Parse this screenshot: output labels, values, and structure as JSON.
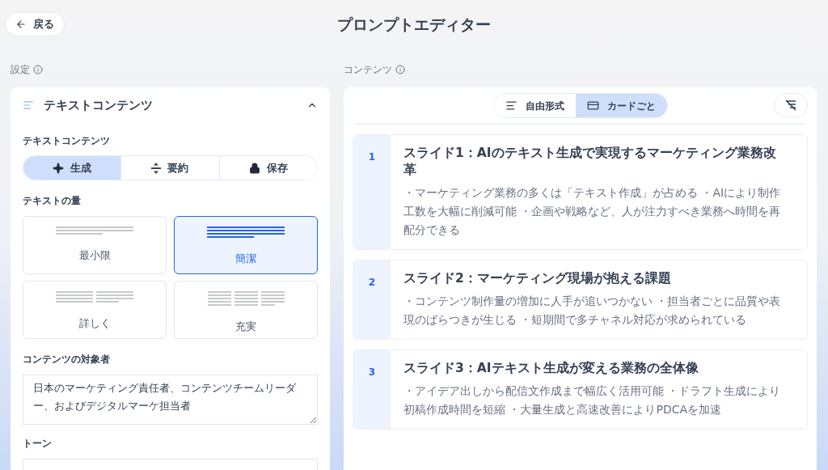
{
  "header": {
    "back_label": "戻る",
    "title": "プロンプトエディター"
  },
  "settings": {
    "label": "設定",
    "panel_title": "テキストコンテンツ",
    "expanded": true,
    "mode_label": "テキストコンテンツ",
    "modes": [
      {
        "kind": "generate",
        "label": "生成",
        "selected": true
      },
      {
        "kind": "summarize",
        "label": "要約",
        "selected": false
      },
      {
        "kind": "preserve",
        "label": "保存",
        "selected": false
      }
    ],
    "amount_label": "テキストの量",
    "amounts": [
      {
        "kind": "minimal",
        "label": "最小限",
        "selected": false
      },
      {
        "kind": "concise",
        "label": "簡潔",
        "selected": true
      },
      {
        "kind": "detailed",
        "label": "詳しく",
        "selected": false
      },
      {
        "kind": "full",
        "label": "充実",
        "selected": false
      }
    ],
    "audience_label": "コンテンツの対象者",
    "audience_value": "日本のマーケティング責任者、コンテンツチームリーダー、およびデジタルマーケ担当者",
    "tone_label": "トーン"
  },
  "content": {
    "label": "コンテンツ",
    "views": [
      {
        "kind": "freeform",
        "label": "自由形式",
        "selected": false
      },
      {
        "kind": "cards",
        "label": "カードごと",
        "selected": true
      }
    ],
    "cards": [
      {
        "number": "1",
        "title": "スライド1：AIのテキスト生成で実現するマーケティング業務改革",
        "body": "・マーケティング業務の多くは「テキスト作成」が占める ・AIにより制作工数を大幅に削減可能 ・企画や戦略など、人が注力すべき業務へ時間を再配分できる"
      },
      {
        "number": "2",
        "title": "スライド2：マーケティング現場が抱える課題",
        "body": "・コンテンツ制作量の増加に人手が追いつかない ・担当者ごとに品質や表現のばらつきが生じる ・短期間で多チャネル対応が求められている"
      },
      {
        "number": "3",
        "title": "スライド3：AIテキスト生成が変える業務の全体像",
        "body": "・アイデア出しから配信文作成まで幅広く活用可能 ・ドラフト生成により初稿作成時間を短縮 ・大量生成と高速改善によりPDCAを加速"
      }
    ]
  }
}
